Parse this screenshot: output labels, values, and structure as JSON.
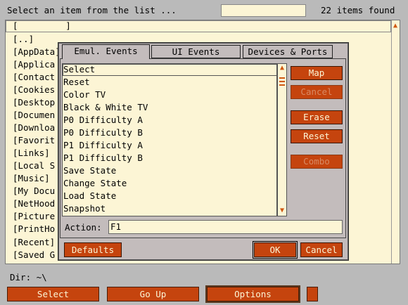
{
  "header": {
    "title": "Select an item from the list ...",
    "filter_value": "",
    "item_count": "22 items found"
  },
  "file_list": {
    "items": [
      "[         ]",
      "[..]",
      "[AppData]",
      "[Applica",
      "[Contact",
      "[Cookies",
      "[Desktop",
      "[Documen",
      "[Downloa",
      "[Favorit",
      "[Links]",
      "[Local S",
      "[Music]",
      "[My Docu",
      "[NetHood",
      "[Picture",
      "[PrintHo",
      "[Recent]",
      "[Saved G"
    ],
    "scroll_up_icon": "triangle-up"
  },
  "directory": {
    "text": "Dir: ~\\"
  },
  "bottom_buttons": {
    "select": "Select",
    "go_up": "Go Up",
    "options": "Options"
  },
  "dialog": {
    "tabs": [
      "Emul. Events",
      "UI Events",
      "Devices & Ports"
    ],
    "active_tab": "Emul. Events",
    "events": [
      "Select",
      "Reset",
      "Color TV",
      "Black & White TV",
      "P0 Difficulty A",
      "P0 Difficulty B",
      "P1 Difficulty A",
      "P1 Difficulty B",
      "Save State",
      "Change State",
      "Load State",
      "Snapshot"
    ],
    "selected_event": "Select",
    "buttons": {
      "map": "Map",
      "cancel_map": "Cancel",
      "erase": "Erase",
      "reset": "Reset",
      "combo": "Combo"
    },
    "action_label": "Action:",
    "action_value": "F1",
    "defaults": "Defaults",
    "ok": "OK",
    "cancel": "Cancel"
  },
  "colors": {
    "button_bg": "#c5440e",
    "button_text": "#fcf5d5",
    "list_bg": "#fcf5d5",
    "panel_bg": "#c3bcbc",
    "page_bg": "#bababa"
  }
}
